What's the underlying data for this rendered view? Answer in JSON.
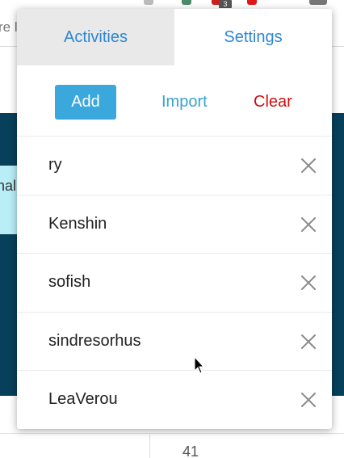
{
  "background": {
    "url_fragment": "re l",
    "side_text": "nal",
    "badge_count": "3",
    "bottom_number": "41",
    "colors": {
      "banner": "#07405a",
      "strip": "#b9eef7"
    }
  },
  "popup": {
    "tabs": [
      {
        "label": "Activities",
        "active": true
      },
      {
        "label": "Settings",
        "active": false
      }
    ],
    "actions": {
      "add": "Add",
      "import": "Import",
      "clear": "Clear"
    },
    "items": [
      {
        "name": "ry"
      },
      {
        "name": "Kenshin"
      },
      {
        "name": "sofish"
      },
      {
        "name": "sindresorhus"
      },
      {
        "name": "LeaVerou"
      }
    ],
    "colors": {
      "accent": "#3aa8dd",
      "tab_text": "#2d86d6",
      "danger": "#d00c0c"
    }
  }
}
